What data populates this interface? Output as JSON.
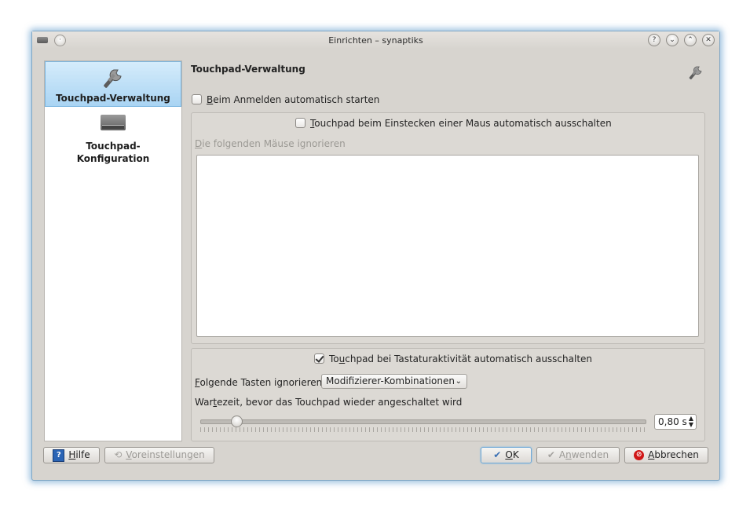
{
  "window": {
    "title": "Einrichten – synaptiks",
    "buttons": {
      "help": "?",
      "minimize": "⌄",
      "maximize": "⌃",
      "close": "✕"
    }
  },
  "sidebar": {
    "items": [
      {
        "label": "Touchpad-Verwaltung",
        "icon": "wrench-icon",
        "active": true
      },
      {
        "label_line1": "Touchpad-",
        "label_line2": "Konfiguration",
        "icon": "touchpad-icon",
        "active": false
      }
    ]
  },
  "main": {
    "title": "Touchpad-Verwaltung",
    "autostart": {
      "label_mnemonic": "B",
      "label_rest": "eim Anmelden automatisch starten",
      "checked": false
    },
    "mouse_group": {
      "checkbox": {
        "label_mnemonic": "T",
        "label_rest": "ouchpad beim Einstecken einer Maus automatisch ausschalten",
        "checked": false
      },
      "ignore_label_mnemonic": "D",
      "ignore_label_rest": "ie folgenden Mäuse ignorieren"
    },
    "keyboard_group": {
      "checkbox": {
        "label_pre": "To",
        "label_mnemonic": "u",
        "label_rest": "chpad bei Tastaturaktivität automatisch ausschalten",
        "checked": true
      },
      "ignore_keys_label_mnemonic": "F",
      "ignore_keys_label_rest": "olgende Tasten ignorieren",
      "ignore_keys_value": "Modifizierer-Kombinationen",
      "delay_label_pre": "War",
      "delay_label_mnemonic": "t",
      "delay_label_rest": "ezeit, bevor das Touchpad wieder angeschaltet wird",
      "delay_value": "0,80 s",
      "delay_fraction": 0.08
    }
  },
  "buttons": {
    "help": {
      "mnemonic": "H",
      "rest": "ilfe"
    },
    "defaults": {
      "mnemonic": "V",
      "rest": "oreinstellungen"
    },
    "ok": {
      "mnemonic": "O",
      "rest": "K"
    },
    "apply": {
      "pre": "A",
      "mnemonic": "n",
      "rest": "wenden"
    },
    "cancel": {
      "mnemonic": "A",
      "rest": "bbrechen"
    }
  },
  "colors": {
    "accent": "#a9d4f3",
    "window_bg": "#d7d4cf"
  }
}
